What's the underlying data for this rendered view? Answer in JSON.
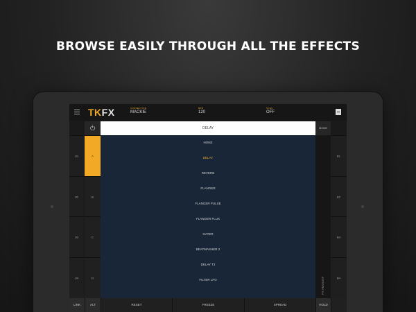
{
  "headline": "BROWSE EASILY THROUGH ALL THE EFFECTS",
  "app": {
    "logo_tk": "TK",
    "logo_fx": "FX",
    "header": {
      "connection_label": "CONNECTION",
      "connection_value": "MACKIE",
      "bpm_label": "BPM",
      "bpm_value": "120",
      "sync_label": "SYNC",
      "sync_value": "OFF"
    },
    "power_icon": "power-icon",
    "dropdown_title": "DELAY",
    "mode_label": "MODE",
    "left_channels": [
      "U1",
      "U2",
      "U3",
      "U4"
    ],
    "deck_buttons": [
      "A",
      "B",
      "C",
      "D"
    ],
    "active_deck": "A",
    "right_channels": [
      "B1",
      "B2",
      "B3",
      "B4"
    ],
    "effects": [
      "NONE",
      "DELAY",
      "REVERB",
      "FLANGER",
      "FLANGER PULSE",
      "FLANGER FLUX",
      "GATER",
      "BEATMASHER 2",
      "DELAY T3",
      "FILTER LFO"
    ],
    "selected_effect": "DELAY",
    "fx_amount_label": "FX AMOUNT",
    "bottom": {
      "link": "LINK",
      "alt": "ALT",
      "reset": "RESET",
      "freeze": "FREEZE",
      "spread": "SPREAD",
      "hold": "HOLD"
    },
    "colors": {
      "accent": "#f1a926",
      "list_bg": "#182637"
    }
  }
}
